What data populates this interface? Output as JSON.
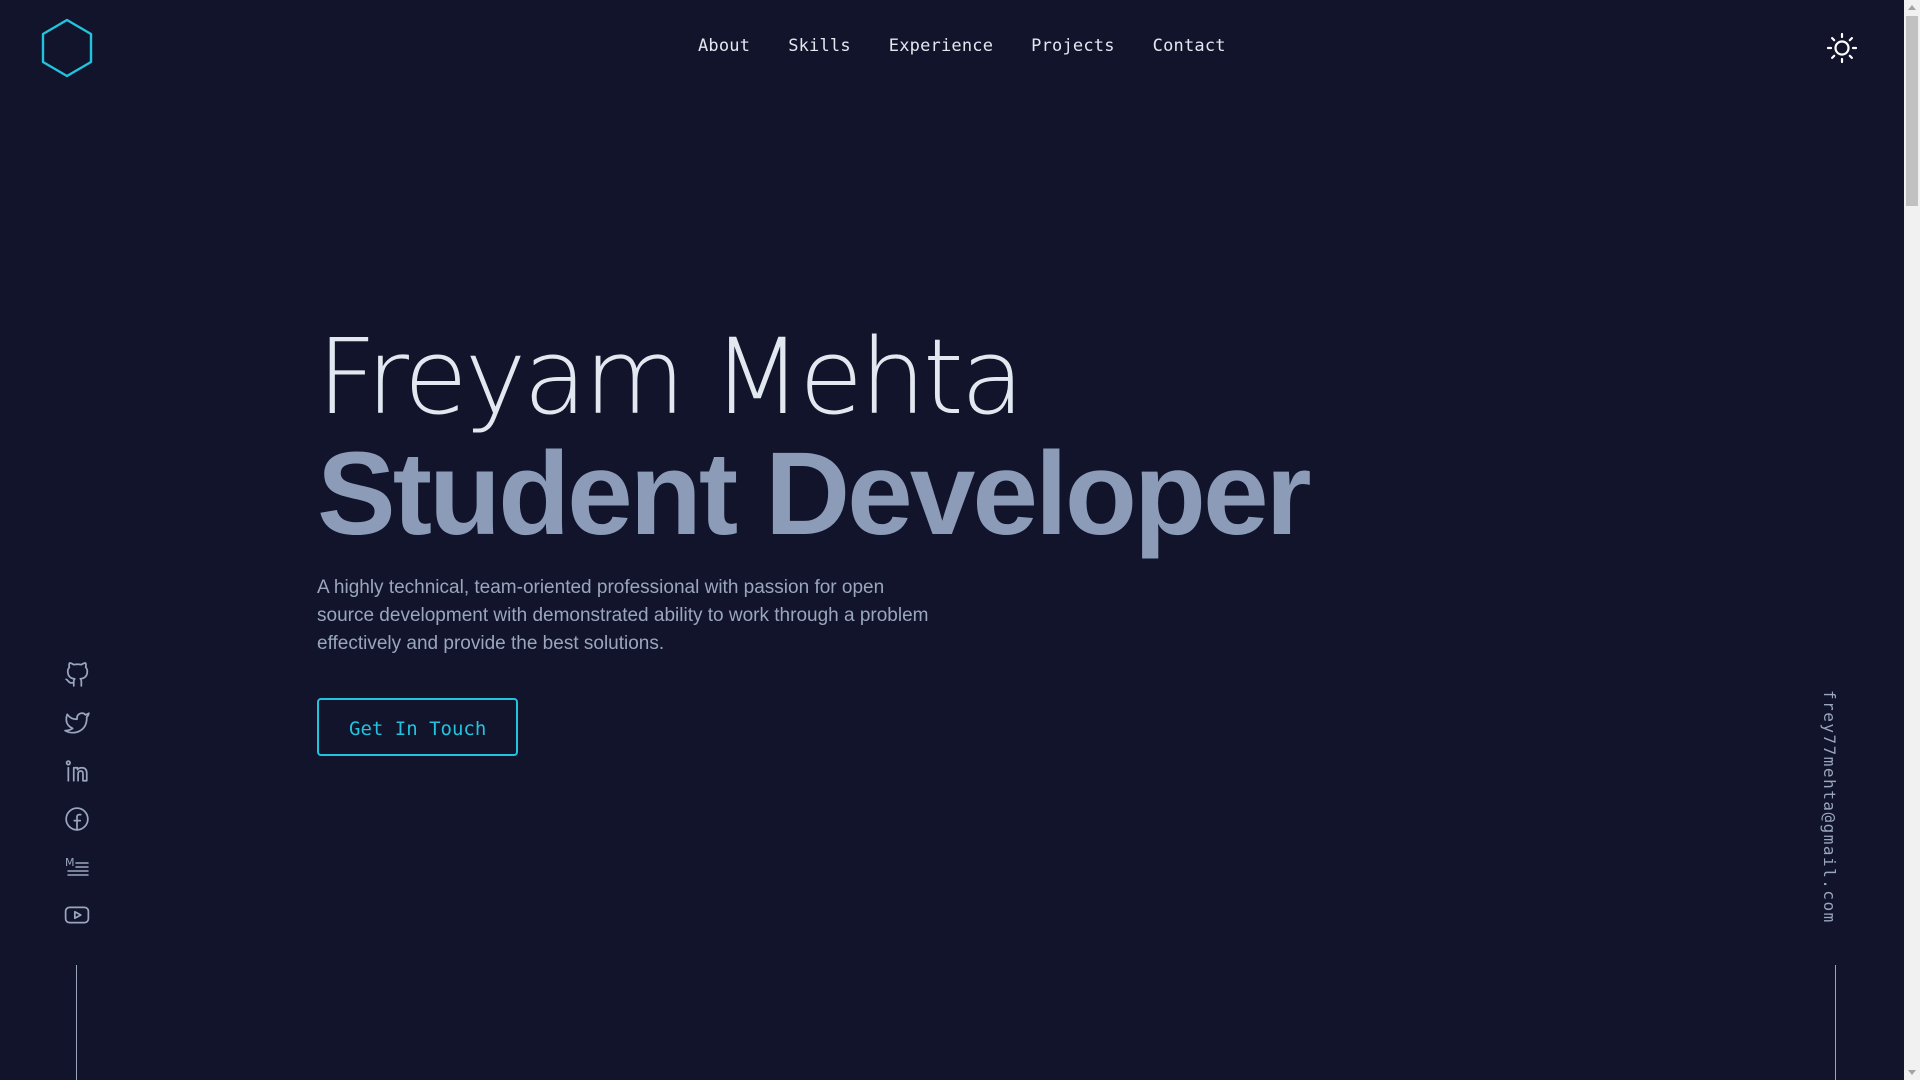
{
  "header": {
    "nav": [
      "About",
      "Skills",
      "Experience",
      "Projects",
      "Contact"
    ],
    "logo_icon": "hexagon-icon",
    "theme_icon": "sun-icon"
  },
  "hero": {
    "name": "Freyam Mehta",
    "role": "Student Developer",
    "description": "A highly technical, team-oriented professional with passion for open source development with demonstrated ability to work through a problem effectively and provide the best solutions.",
    "cta_label": "Get In Touch"
  },
  "social": [
    "github-icon",
    "twitter-icon",
    "linkedin-icon",
    "facebook-icon",
    "medium-icon",
    "youtube-icon"
  ],
  "email": "frey77mehta@gmail.com",
  "colors": {
    "background": "#11142a",
    "accent": "#22c3de",
    "heading": "#e2e8f0",
    "subheading": "#8b9bb8",
    "muted": "#9aa6bd"
  }
}
